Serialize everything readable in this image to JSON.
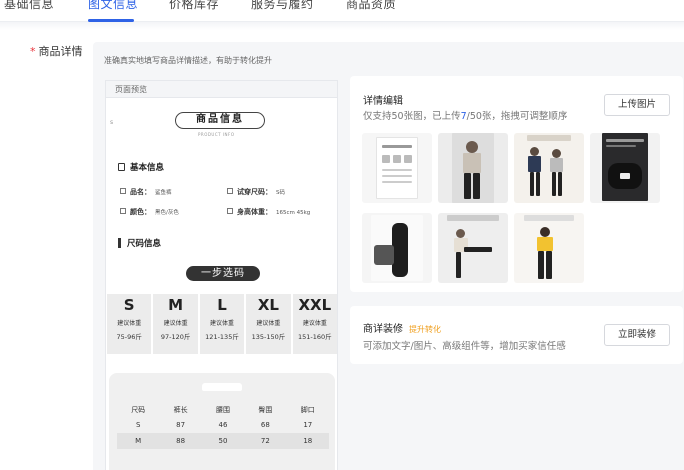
{
  "tabs": [
    {
      "label": "基础信息",
      "active": false
    },
    {
      "label": "图文信息",
      "active": true
    },
    {
      "label": "价格库存",
      "active": false
    },
    {
      "label": "服务与履约",
      "active": false
    },
    {
      "label": "商品资质",
      "active": false
    }
  ],
  "field": {
    "required_mark": "*",
    "label": "商品详情"
  },
  "hint": "准确真实地填写商品详情描述，有助于转化提升",
  "preview": {
    "header": "页面预览",
    "title": "商品信息",
    "subtitle": "PRODUCT INFO",
    "basic_section": "基本信息",
    "items": [
      {
        "label": "品名：",
        "value": "鲨鱼裤"
      },
      {
        "label": "试穿尺码：",
        "value": "S码"
      },
      {
        "label": "颜色：",
        "value": "黑色/灰色"
      },
      {
        "label": "身高体重：",
        "value": "165cm 45kg"
      }
    ],
    "size_section": "尺码信息",
    "one_step": "一步选码",
    "sizes": [
      {
        "size": "S",
        "label": "建议体重",
        "range": "75-96斤"
      },
      {
        "size": "M",
        "label": "建议体重",
        "range": "97-120斤"
      },
      {
        "size": "L",
        "label": "建议体重",
        "range": "121-135斤"
      },
      {
        "size": "XL",
        "label": "建议体重",
        "range": "135-150斤"
      },
      {
        "size": "XXL",
        "label": "建议体重",
        "range": "151-160斤"
      }
    ],
    "measure_headers": [
      "尺码",
      "裤长",
      "腰围",
      "臀围",
      "脚口"
    ],
    "measure_rows": [
      [
        "S",
        "87",
        "46",
        "68",
        "17"
      ],
      [
        "M",
        "88",
        "50",
        "72",
        "18"
      ]
    ]
  },
  "detail_edit": {
    "title": "详情编辑",
    "sub_prefix": "仅支持50张图，已上传",
    "uploaded": "7",
    "sub_suffix": "/50张，拖拽可调整顺序",
    "upload_button": "上传图片",
    "thumbnails": [
      {
        "icon": "product-spec-sheet-thumbnail"
      },
      {
        "icon": "model-photo-thumbnail"
      },
      {
        "icon": "model-group-thumbnail"
      },
      {
        "icon": "product-detail-dark-thumbnail"
      },
      {
        "icon": "leggings-closeup-thumbnail"
      },
      {
        "icon": "model-stretch-thumbnail"
      },
      {
        "icon": "model-yellow-top-thumbnail"
      }
    ]
  },
  "decoration": {
    "title": "商详装修",
    "tag": "提升转化",
    "sub": "可添加文字/图片、高级组件等，增加买家信任感",
    "button": "立即装修"
  },
  "colors": {
    "accent": "#2e62e6",
    "required": "#e8333a",
    "tag": "#f0a020"
  }
}
